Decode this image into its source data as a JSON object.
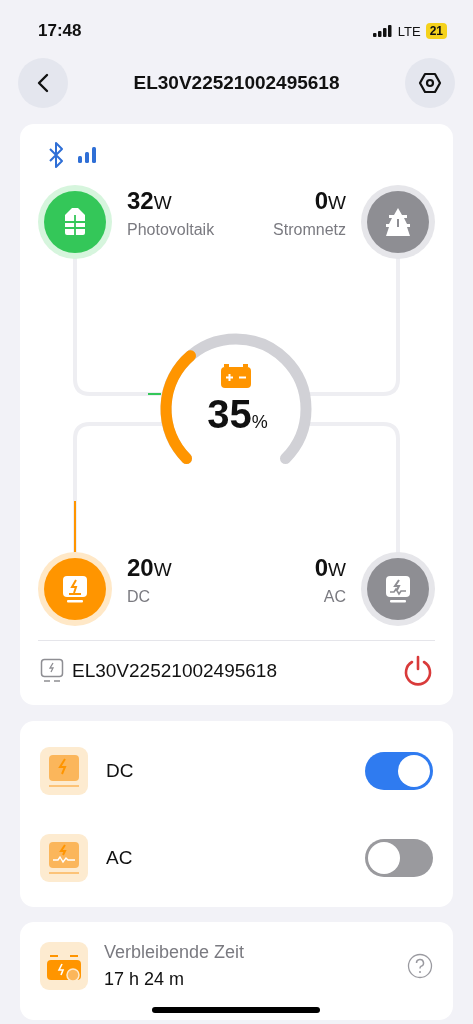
{
  "status_bar": {
    "time": "17:48",
    "network": "LTE",
    "battery": "21"
  },
  "header": {
    "title": "EL30V22521002495618"
  },
  "flow": {
    "nodes": [
      {
        "kind": "solar",
        "value": "32",
        "unit": "W",
        "label": "Photovoltaik",
        "active": true
      },
      {
        "kind": "grid",
        "value": "0",
        "unit": "W",
        "label": "Stromnetz",
        "active": false
      },
      {
        "kind": "dc",
        "value": "20",
        "unit": "W",
        "label": "DC",
        "active": true
      },
      {
        "kind": "ac",
        "value": "0",
        "unit": "W",
        "label": "AC",
        "active": false
      }
    ],
    "battery": {
      "value": "35",
      "unit": "%"
    }
  },
  "device": {
    "name": "EL30V22521002495618"
  },
  "outputs": [
    {
      "kind": "dc",
      "label": "DC",
      "on": true
    },
    {
      "kind": "ac",
      "label": "AC",
      "on": false
    }
  ],
  "remaining": {
    "label": "Verbleibende Zeit",
    "value": "17 h 24 m"
  }
}
